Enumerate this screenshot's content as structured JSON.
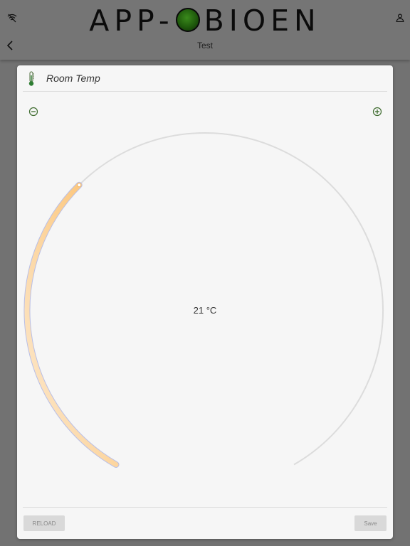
{
  "header": {
    "brand_left": "APP-",
    "brand_right": "BIOEN",
    "subtitle": "Test",
    "icons": {
      "wifi": "wifi-off-icon",
      "user": "user-icon",
      "back": "chevron-left-icon"
    }
  },
  "widget": {
    "title": "Room Temp",
    "icon": "thermometer-icon",
    "value_text": "21 °C",
    "minus_icon": "minus-circle-icon",
    "plus_icon": "plus-circle-icon",
    "level_fraction": 0.35
  },
  "footer": {
    "reload_label": "RELOAD",
    "save_label": "Save"
  },
  "colors": {
    "topbar": "#757575",
    "card": "#f6f6f6",
    "accent": "#2e7d32",
    "arc_fill_start": "#fdebd3",
    "arc_fill_end": "#fbbf6b",
    "track": "#dcdcdc"
  }
}
